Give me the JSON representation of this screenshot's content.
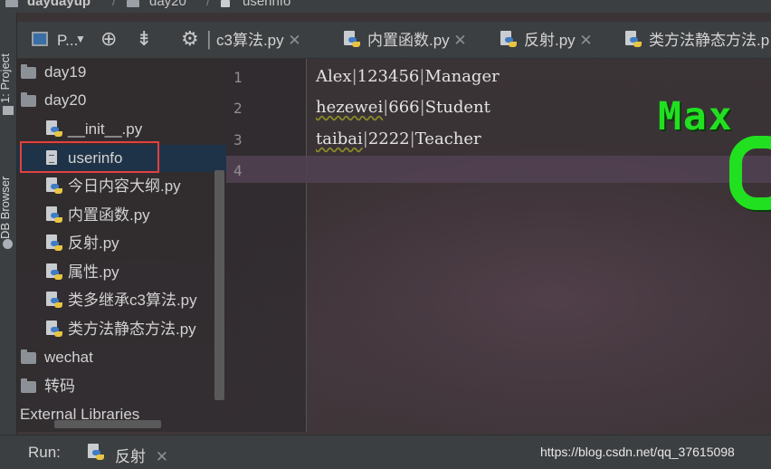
{
  "breadcrumb": {
    "project": "daydayup",
    "folder": "day20",
    "file": "userinfo"
  },
  "toolstrip": {
    "project_tab": "1: Project",
    "db_tab": "DB Browser"
  },
  "project_panel": {
    "view_label": "P..."
  },
  "tree": [
    {
      "label": "day19",
      "kind": "folder"
    },
    {
      "label": "day20",
      "kind": "folder"
    },
    {
      "label": "__init__.py",
      "kind": "py"
    },
    {
      "label": "userinfo",
      "kind": "text",
      "selected": true
    },
    {
      "label": "今日内容大纲.py",
      "kind": "py"
    },
    {
      "label": "内置函数.py",
      "kind": "py"
    },
    {
      "label": "反射.py",
      "kind": "py"
    },
    {
      "label": "属性.py",
      "kind": "py"
    },
    {
      "label": "类多继承c3算法.py",
      "kind": "py"
    },
    {
      "label": "类方法静态方法.py",
      "kind": "py"
    },
    {
      "label": "wechat",
      "kind": "folder"
    },
    {
      "label": "转码",
      "kind": "folder"
    },
    {
      "label": "External Libraries",
      "kind": "lib"
    }
  ],
  "tabs": [
    {
      "label": "c3算法.py"
    },
    {
      "label": "内置函数.py"
    },
    {
      "label": "反射.py"
    },
    {
      "label": "类方法静态方法.p"
    }
  ],
  "editor": {
    "line_numbers": [
      "1",
      "2",
      "3",
      "4"
    ],
    "lines": [
      [
        "Alex",
        "123456",
        "Manager"
      ],
      [
        "hezewei",
        "666",
        "Student"
      ],
      [
        "taibai",
        "2222",
        "Teacher"
      ]
    ],
    "separator": "|"
  },
  "overlay": {
    "text": "Max"
  },
  "run": {
    "label": "Run:",
    "tab": "反射"
  },
  "watermark": "https://blog.csdn.net/qq_37615098",
  "colors": {
    "accent_green": "#21e020",
    "selection": "#1f3348",
    "highlight_box": "#e34040"
  }
}
